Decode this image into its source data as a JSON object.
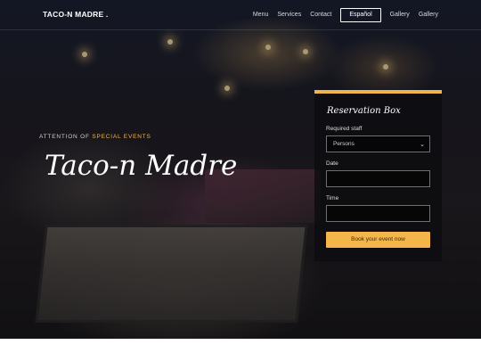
{
  "nav": {
    "brand": "TACO-N MADRE .",
    "links": [
      "Menu",
      "Services",
      "Contact",
      "Español",
      "Gallery",
      "Gallery"
    ]
  },
  "hero": {
    "eyebrow_prefix": "ATTENTION OF ",
    "eyebrow_highlight": "SPECIAL EVENTS",
    "title": "Taco-n Madre"
  },
  "reservation": {
    "title": "Reservation Box",
    "staff_label": "Required staff",
    "staff_value": "Persons",
    "date_label": "Date",
    "date_value": "",
    "time_label": "Time",
    "time_value": "",
    "button_label": "Book your event now"
  },
  "colors": {
    "accent": "#f0b54a",
    "button": "#f4b54a"
  }
}
